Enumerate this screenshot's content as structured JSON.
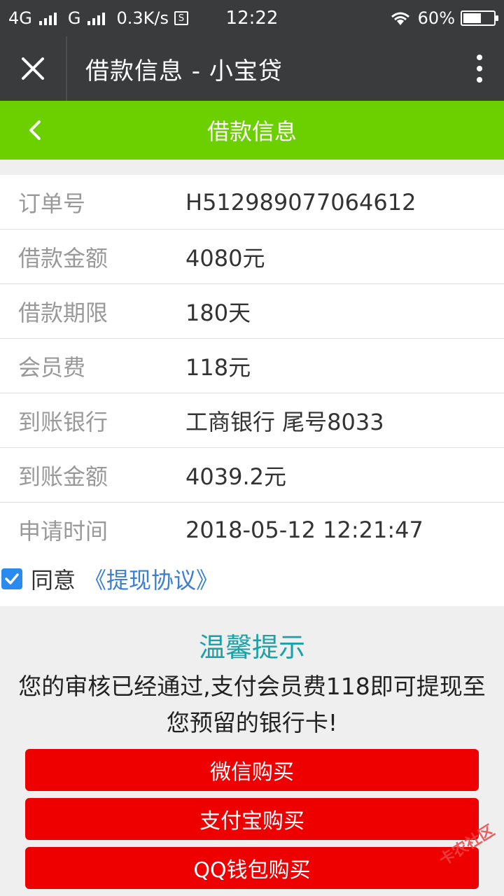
{
  "status_bar": {
    "network_left": "4G",
    "network_right": "G",
    "speed": "0.3K/s",
    "net_badge": "S",
    "time": "12:22",
    "battery_percent": "60%",
    "battery_level": 0.6
  },
  "title_bar": {
    "title": "借款信息 - 小宝贷"
  },
  "header": {
    "title": "借款信息"
  },
  "info": [
    {
      "label": "订单号",
      "value": "H512989077064612"
    },
    {
      "label": "借款金额",
      "value": "4080元"
    },
    {
      "label": "借款期限",
      "value": "180天"
    },
    {
      "label": "会员费",
      "value": "118元"
    },
    {
      "label": "到账银行",
      "value": "工商银行 尾号8033"
    },
    {
      "label": "到账金额",
      "value": "4039.2元"
    },
    {
      "label": "申请时间",
      "value": "2018-05-12 12:21:47"
    }
  ],
  "agreement": {
    "checked": true,
    "text": "同意",
    "link": "《提现协议》"
  },
  "tip": {
    "title": "温馨提示",
    "line1": "您的审核已经通过,支付会员费118即可提现至",
    "line2": "您预留的银行卡!"
  },
  "buttons": {
    "wechat": "微信购买",
    "alipay": "支付宝购买",
    "qq": "QQ钱包购买"
  },
  "watermark": "卡农社区",
  "colors": {
    "title_bar_bg": "#3a3b3d",
    "header_bg": "#6ccf00",
    "button_bg": "#ee0000",
    "tip_title": "#1aa2a8",
    "link": "#3a7fd0"
  }
}
